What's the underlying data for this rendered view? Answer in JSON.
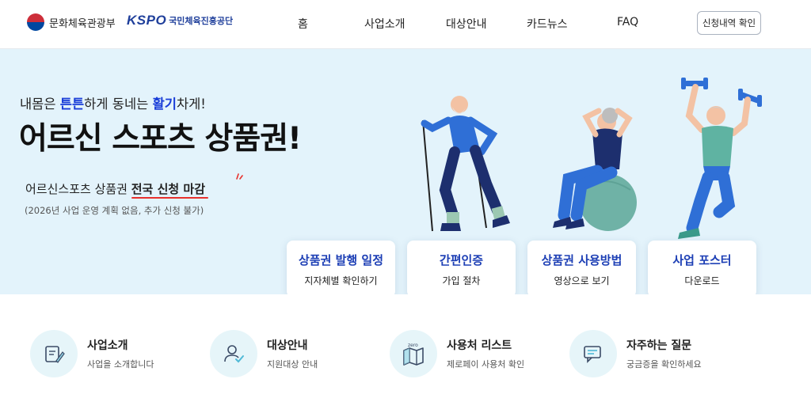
{
  "header": {
    "ministry_name": "문화체육관광부",
    "kspo_logo": "KSPO",
    "kspo_name": "국민체육진흥공단",
    "nav": [
      "홈",
      "사업소개",
      "대상안내",
      "카드뉴스",
      "FAQ"
    ],
    "check_button": "신청내역 확인"
  },
  "hero": {
    "tagline_1": "내몸은 ",
    "tagline_hl1": "튼튼",
    "tagline_2": "하게 동네는 ",
    "tagline_hl2": "활기",
    "tagline_3": "차게!",
    "title": "어르신 스포츠 상품권!",
    "notice_plain": "어르신스포츠 상품권 ",
    "notice_em": "전국 신청 마감",
    "notice_sub": "(2026년 사업 운영 계획 없음, 추가 신청 불가)"
  },
  "cards": [
    {
      "title": "상품권 발행 일정",
      "sub": "지자체별 확인하기"
    },
    {
      "title": "간편인증",
      "sub": "가입 절차"
    },
    {
      "title": "상품권 사용방법",
      "sub": "영상으로 보기"
    },
    {
      "title": "사업 포스터",
      "sub": "다운로드"
    }
  ],
  "quick_links": [
    {
      "title": "사업소개",
      "desc": "사업을 소개합니다",
      "icon": "document-pen-icon"
    },
    {
      "title": "대상안내",
      "desc": "지원대상 안내",
      "icon": "user-check-icon"
    },
    {
      "title": "사용처 리스트",
      "desc": "제로페이 사용처 확인",
      "icon": "zero-map-icon",
      "icon_label": "zero"
    },
    {
      "title": "자주하는 질문",
      "desc": "궁금증을 확인하세요",
      "icon": "chat-bubble-icon"
    }
  ],
  "colors": {
    "hero_bg": "#e3f3fb",
    "accent_blue": "#1d3fb5",
    "highlight_blue": "#1a3ed8",
    "underline_red": "#e8312c",
    "icon_circle": "#e6f5f9"
  }
}
